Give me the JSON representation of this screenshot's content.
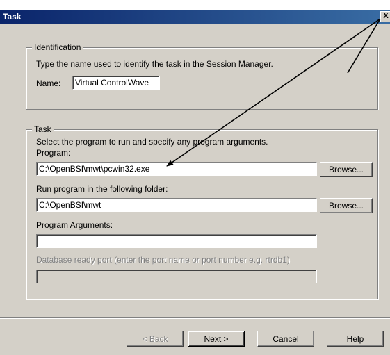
{
  "dialog": {
    "title": "Task",
    "close_glyph": "X"
  },
  "identification": {
    "legend": "Identification",
    "description": "Type the name used to identify the task in the Session Manager.",
    "name_label": "Name:",
    "name_value": "Virtual ControlWave"
  },
  "task": {
    "legend": "Task",
    "description": "Select the program to run and specify any program arguments.",
    "program_label": "Program:",
    "program_value": "C:\\OpenBSI\\mwt\\pcwin32.exe",
    "program_browse": "Browse...",
    "folder_label": "Run program in the following folder:",
    "folder_value": "C:\\OpenBSI\\mwt",
    "folder_browse": "Browse...",
    "args_label": "Program Arguments:",
    "args_value": "",
    "db_port_label": "Database ready port (enter the port name or port number e.g. rtrdb1)",
    "db_port_value": ""
  },
  "buttons": {
    "back": "< Back",
    "next": "Next >",
    "cancel": "Cancel",
    "help": "Help"
  },
  "colors": {
    "face": "#d4d0c8",
    "titlebar": "#0a246a",
    "arrow": "#000000"
  }
}
